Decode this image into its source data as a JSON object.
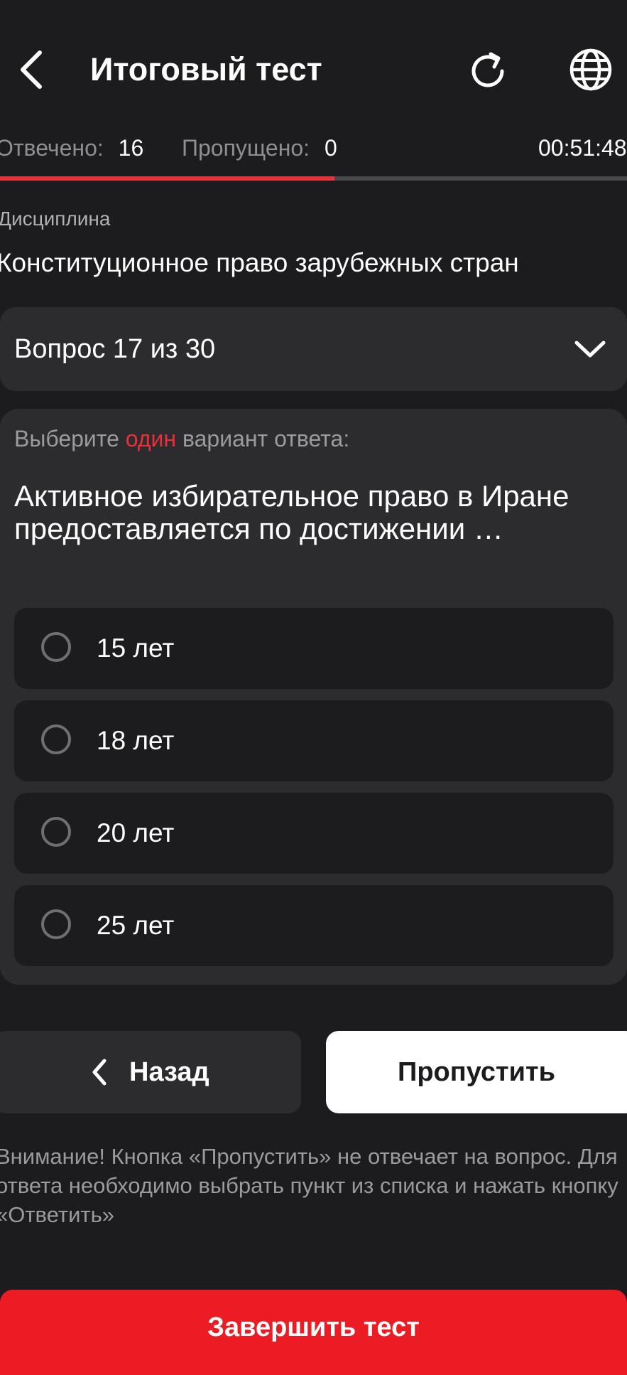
{
  "header": {
    "title": "Итоговый тест",
    "back_icon": "chevron-left-icon",
    "refresh_icon": "refresh-icon",
    "language_icon": "globe-icon"
  },
  "stats": {
    "answered_label": "Отвечено:",
    "answered_value": "16",
    "skipped_label": "Пропущено:",
    "skipped_value": "0",
    "timer": "00:51:48"
  },
  "progress": {
    "fraction": 0.5333,
    "fill_color": "#e8303a",
    "track_color": "#48484a"
  },
  "discipline": {
    "label": "Дисциплина",
    "value": "Конституционное право зарубежных стран"
  },
  "question_selector": {
    "label": "Вопрос 17 из 30",
    "icon": "chevron-down-icon"
  },
  "question": {
    "instruction_before": "Выберите",
    "instruction_accent": "один",
    "instruction_after": "вариант ответа:",
    "text": "Активное избирательное право в Иране предоставляется по достижении …",
    "options": [
      {
        "label": "15 лет"
      },
      {
        "label": "18 лет"
      },
      {
        "label": "20 лет"
      },
      {
        "label": "25 лет"
      }
    ]
  },
  "actions": {
    "back_label": "Назад",
    "skip_label": "Пропустить",
    "finish_label": "Завершить тест"
  },
  "warning": "Внимание! Кнопка «Пропустить» не отвечает на вопрос. Для ответа необходимо выбрать пункт из списка и нажать кнопку «Ответить»",
  "colors": {
    "background": "#1c1c1e",
    "card": "#2c2c2e",
    "accent": "#e8303a",
    "finish_button": "#ec1c24"
  }
}
